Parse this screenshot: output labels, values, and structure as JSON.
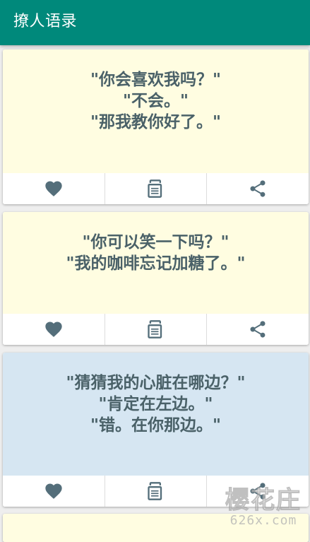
{
  "appbar": {
    "title": "撩人语录",
    "color": "#00897b"
  },
  "cards": [
    {
      "background": "#fffde1",
      "lines": [
        "\"你会喜欢我吗？\"",
        "\"不会。\"",
        "\"那我教你好了。\""
      ],
      "actions": [
        "heart-icon",
        "copy-icon",
        "share-icon"
      ]
    },
    {
      "background": "#fffde1",
      "lines": [
        "\"你可以笑一下吗？\"",
        "\"我的咖啡忘记加糖了。\""
      ],
      "actions": [
        "heart-icon",
        "copy-icon",
        "share-icon"
      ]
    },
    {
      "background": "#d6e6f2",
      "lines": [
        "\"猜猜我的心脏在哪边？\"",
        "\"肯定在左边。\"",
        "\"错。在你那边。\""
      ],
      "actions": [
        "heart-icon",
        "copy-icon",
        "share-icon"
      ]
    },
    {
      "background": "#fffde1",
      "lines": [],
      "actions": []
    }
  ],
  "watermark": {
    "main": "樱花庄",
    "sub": "626x.com"
  }
}
